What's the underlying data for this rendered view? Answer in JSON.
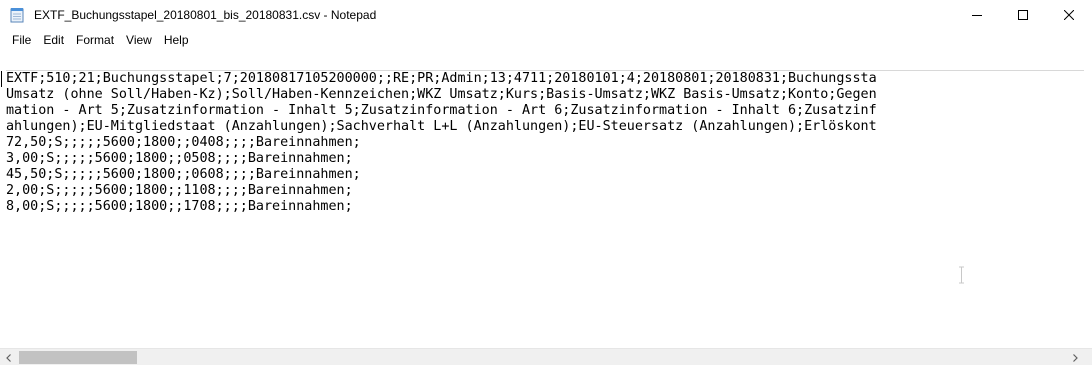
{
  "window": {
    "title": "EXTF_Buchungsstapel_20180801_bis_20180831.csv - Notepad",
    "icon": "notepad-icon"
  },
  "menu": {
    "items": [
      "File",
      "Edit",
      "Format",
      "View",
      "Help"
    ]
  },
  "editor": {
    "lines": [
      "EXTF;510;21;Buchungsstapel;7;20180817105200000;;RE;PR;Admin;13;4711;20180101;4;20180801;20180831;Buchungssta",
      "Umsatz (ohne Soll/Haben-Kz);Soll/Haben-Kennzeichen;WKZ Umsatz;Kurs;Basis-Umsatz;WKZ Basis-Umsatz;Konto;Gegen",
      "mation - Art 5;Zusatzinformation - Inhalt 5;Zusatzinformation - Art 6;Zusatzinformation - Inhalt 6;Zusatzinf",
      "ahlungen);EU-Mitgliedstaat (Anzahlungen);Sachverhalt L+L (Anzahlungen);EU-Steuersatz (Anzahlungen);Erlöskont",
      "72,50;S;;;;;5600;1800;;0408;;;;Bareinnahmen;",
      "3,00;S;;;;;5600;1800;;0508;;;;Bareinnahmen;",
      "45,50;S;;;;;5600;1800;;0608;;;;Bareinnahmen;",
      "2,00;S;;;;;5600;1800;;1108;;;;Bareinnahmen;",
      "8,00;S;;;;;5600;1800;;1708;;;;Bareinnahmen;"
    ]
  },
  "colors": {
    "scroll_track": "#f0f0f0",
    "scroll_thumb": "#c2c2c2",
    "icon_blue": "#4a90d9"
  }
}
